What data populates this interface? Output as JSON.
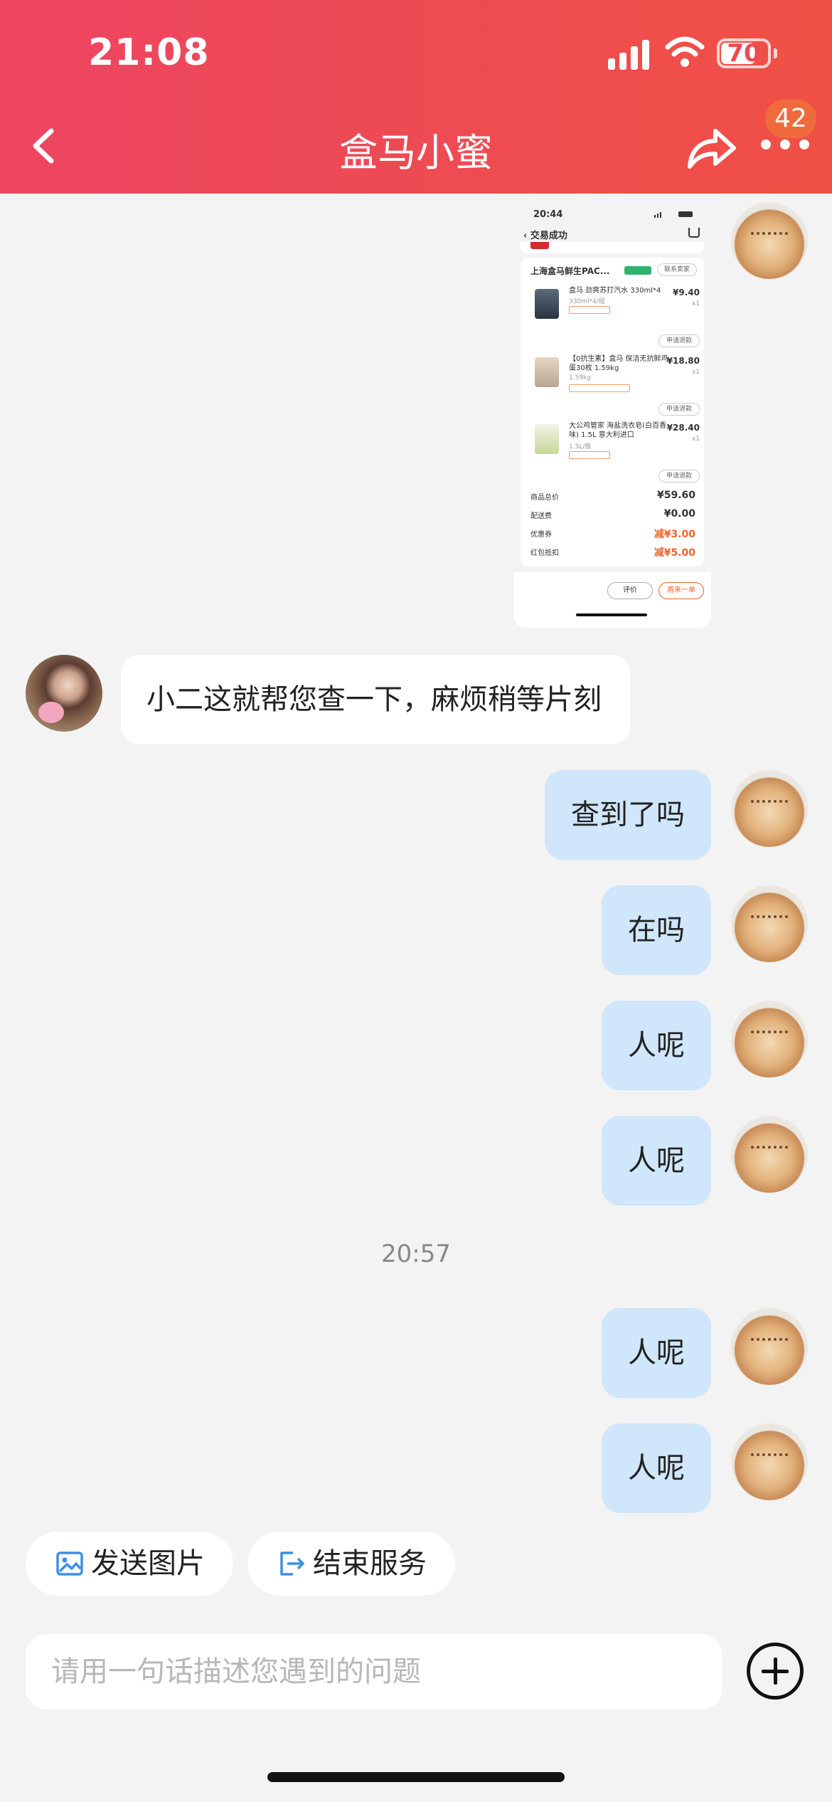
{
  "status_bar": {
    "time": "21:08",
    "battery": "70"
  },
  "header": {
    "title": "盒马小蜜",
    "badge": "42"
  },
  "screenshot_message": {
    "time": "20:44",
    "nav_title": "交易成功",
    "store": "上海盒马鲜生PAC...",
    "contact": "联系卖家",
    "items": [
      {
        "name": "盒马 劲爽苏打汽水 330ml*4",
        "spec": "330ml*4/组",
        "price": "¥9.40",
        "qty": "x1",
        "refund": "申请退款"
      },
      {
        "name": "【0抗生素】盒马 保洁无抗鲜鸡蛋30枚 1.59kg",
        "spec": "1.59kg",
        "price": "¥18.80",
        "qty": "x1",
        "refund": "申请退款"
      },
      {
        "name": "大公鸡管家 海盐洗衣皂(白百香味) 1.5L 意大利进口",
        "spec": "1.5L/瓶",
        "price": "¥28.40",
        "qty": "x1",
        "refund": "申请退款"
      }
    ],
    "summary": [
      {
        "label": "商品总价",
        "value": "¥59.60"
      },
      {
        "label": "配送费",
        "value": "¥0.00"
      },
      {
        "label": "优惠券",
        "value": "减¥3.00"
      },
      {
        "label": "红包抵扣",
        "value": "减¥5.00"
      }
    ],
    "btn_review": "评价",
    "btn_rebuy": "再来一单"
  },
  "messages": [
    {
      "from": "agent",
      "text": "小二这就帮您查一下，麻烦稍等片刻"
    },
    {
      "from": "me",
      "text": "查到了吗"
    },
    {
      "from": "me",
      "text": "在吗"
    },
    {
      "from": "me",
      "text": "人呢"
    },
    {
      "from": "me",
      "text": "人呢"
    },
    {
      "from": "me",
      "text": "人呢"
    },
    {
      "from": "me",
      "text": "人呢"
    }
  ],
  "timestamp": "20:57",
  "quick_actions": {
    "send_image": "发送图片",
    "end_service": "结束服务"
  },
  "input": {
    "placeholder": "请用一句话描述您遇到的问题"
  },
  "icons": [
    "back-icon",
    "share-icon",
    "more-icon",
    "image-icon",
    "exit-icon",
    "plus-icon"
  ],
  "colors": {
    "header_start": "#ee4562",
    "header_end": "#ef5045",
    "my_bubble": "#cfe6fb",
    "badge": "#ef6b3c"
  }
}
